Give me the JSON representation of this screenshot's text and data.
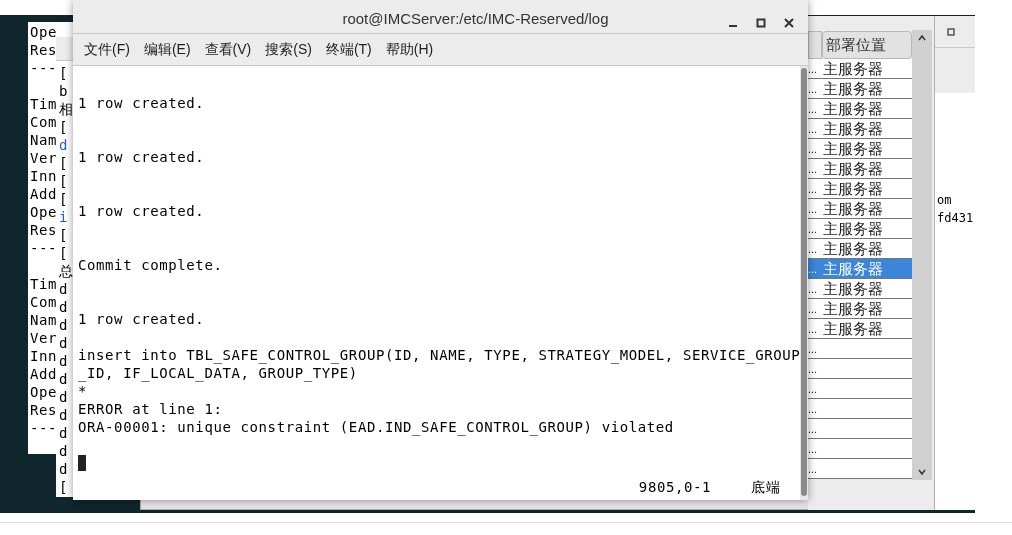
{
  "back_terminal": {
    "blocks": [
      [
        "Ope",
        "Res",
        "---"
      ],
      [
        "Tim",
        "Com",
        "Nam",
        "Ver",
        "Inn",
        "Add",
        "Ope",
        "Res",
        "---"
      ],
      [
        "Tim",
        "Com",
        "Nam",
        "Ver",
        "Inn",
        "Add",
        "Ope",
        "Res",
        "---"
      ]
    ]
  },
  "middle_terminal": {
    "lines": [
      {
        "kind": "plain",
        "text": "["
      },
      {
        "kind": "plain",
        "text": "b"
      },
      {
        "kind": "plain",
        "text": "相"
      },
      {
        "kind": "plain",
        "text": "["
      },
      {
        "kind": "link",
        "text": "d"
      },
      {
        "kind": "plain",
        "text": "["
      },
      {
        "kind": "plain",
        "text": "["
      },
      {
        "kind": "plain",
        "text": "["
      },
      {
        "kind": "link",
        "text": "i"
      },
      {
        "kind": "plain",
        "text": "["
      },
      {
        "kind": "plain",
        "text": "["
      },
      {
        "kind": "plain",
        "text": "总"
      },
      {
        "kind": "plain",
        "text": "d"
      },
      {
        "kind": "plain",
        "text": "d"
      },
      {
        "kind": "plain",
        "text": "d"
      },
      {
        "kind": "plain",
        "text": "d"
      },
      {
        "kind": "plain",
        "text": "d"
      },
      {
        "kind": "plain",
        "text": "d"
      },
      {
        "kind": "plain",
        "text": "d"
      },
      {
        "kind": "plain",
        "text": "d"
      },
      {
        "kind": "plain",
        "text": "d"
      },
      {
        "kind": "plain",
        "text": "d"
      },
      {
        "kind": "plain",
        "text": "d"
      },
      {
        "kind": "plain",
        "text": "["
      }
    ]
  },
  "terminal": {
    "title": "root@IMCServer:/etc/IMC-Reserved/log",
    "menu": [
      "文件(F)",
      "编辑(E)",
      "查看(V)",
      "搜索(S)",
      "终端(T)",
      "帮助(H)"
    ],
    "lines": [
      {
        "kind": "blank"
      },
      {
        "kind": "text",
        "text": "1 row created."
      },
      {
        "kind": "blank"
      },
      {
        "kind": "blank"
      },
      {
        "kind": "text",
        "text": "1 row created."
      },
      {
        "kind": "blank"
      },
      {
        "kind": "blank"
      },
      {
        "kind": "text",
        "text": "1 row created."
      },
      {
        "kind": "blank"
      },
      {
        "kind": "blank"
      },
      {
        "kind": "text",
        "text": "Commit complete."
      },
      {
        "kind": "blank"
      },
      {
        "kind": "blank"
      },
      {
        "kind": "text",
        "text": "1 row created."
      },
      {
        "kind": "blank"
      },
      {
        "kind": "text",
        "text": "insert into TBL_SAFE_CONTROL_GROUP(ID, NAME, TYPE, STRATEGY_MODEL, SERVICE_GROUP"
      },
      {
        "kind": "text",
        "text": "_ID, IF_LOCAL_DATA, GROUP_TYPE)"
      },
      {
        "kind": "text",
        "text": "*"
      },
      {
        "kind": "text",
        "text": "ERROR at line 1:"
      },
      {
        "kind": "text",
        "text": "ORA-00001: unique constraint (EAD.IND_SAFE_CONTROL_GROUP) violated"
      },
      {
        "kind": "blank"
      },
      {
        "kind": "cursor"
      }
    ],
    "position": "9805,0-1",
    "scroll_position": "底端"
  },
  "table": {
    "header": "部署位置",
    "rows": [
      {
        "column_1": "...",
        "location": "主服务器",
        "selected": false
      },
      {
        "column_1": "...",
        "location": "主服务器",
        "selected": false
      },
      {
        "column_1": "...",
        "location": "主服务器",
        "selected": false
      },
      {
        "column_1": "...",
        "location": "主服务器",
        "selected": false
      },
      {
        "column_1": "...",
        "location": "主服务器",
        "selected": false
      },
      {
        "column_1": "...",
        "location": "主服务器",
        "selected": false
      },
      {
        "column_1": "...",
        "location": "主服务器",
        "selected": false
      },
      {
        "column_1": "...",
        "location": "主服务器",
        "selected": false
      },
      {
        "column_1": "...",
        "location": "主服务器",
        "selected": false
      },
      {
        "column_1": "...",
        "location": "主服务器",
        "selected": false
      },
      {
        "column_1": "...",
        "location": "主服务器",
        "selected": true
      },
      {
        "column_1": "...",
        "location": "主服务器",
        "selected": false
      },
      {
        "column_1": "...",
        "location": "主服务器",
        "selected": false
      },
      {
        "column_1": "...",
        "location": "主服务器",
        "selected": false
      },
      {
        "column_1": "...",
        "selected": false
      },
      {
        "column_1": "...",
        "selected": false
      },
      {
        "column_1": "...",
        "selected": false
      },
      {
        "column_1": "...",
        "selected": false
      },
      {
        "column_1": "...",
        "selected": false
      },
      {
        "column_1": "...",
        "selected": false
      },
      {
        "column_1": "...",
        "selected": false
      }
    ]
  },
  "right_window": {
    "lines": [
      "om",
      "fd431"
    ]
  }
}
